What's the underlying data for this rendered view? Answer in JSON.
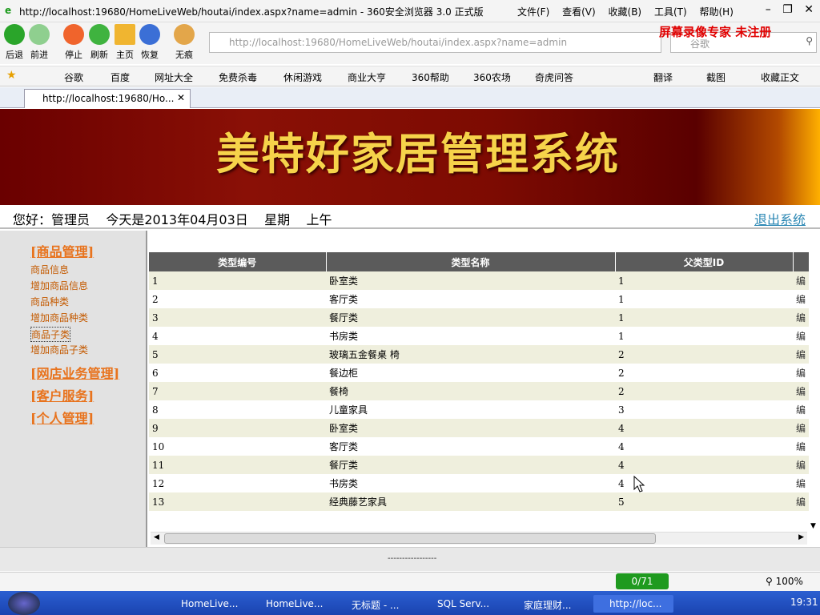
{
  "window": {
    "title": "http://localhost:19680/HomeLiveWeb/houtai/index.aspx?name=admin - 360安全浏览器 3.0 正式版",
    "menu": [
      "文件(F)",
      "查看(V)",
      "收藏(B)",
      "工具(T)",
      "帮助(H)"
    ]
  },
  "watermark": "屏幕录像专家  未注册",
  "toolbar": {
    "buttons": [
      "后退",
      "前进",
      "停止",
      "刷新",
      "主页",
      "恢复",
      "无痕"
    ],
    "address": "http://localhost:19680/HomeLiveWeb/houtai/index.aspx?name=admin",
    "search_placeholder": "谷歌"
  },
  "favorites": [
    "谷歌",
    "百度",
    "网址大全",
    "免费杀毒",
    "休闲游戏",
    "商业大亨",
    "360帮助",
    "360农场",
    "奇虎问答",
    "翻译",
    "截图",
    "收藏正文"
  ],
  "tab": {
    "label": "http://localhost:19680/Ho..."
  },
  "banner": {
    "title": "美特好家居管理系统"
  },
  "info": {
    "greeting": "您好：管理员    今天是2013年04月03日    星期    上午",
    "logout": "退出系统"
  },
  "sidebar": {
    "sections": [
      {
        "title": "[商品管理]",
        "items": [
          "商品信息",
          "增加商品信息",
          "商品种类",
          "增加商品种类",
          "商品子类",
          "增加商品子类"
        ]
      },
      {
        "title": "[网店业务管理]",
        "items": []
      },
      {
        "title": "[客户服务]",
        "items": []
      },
      {
        "title": "[个人管理]",
        "items": []
      }
    ]
  },
  "grid": {
    "headers": [
      "类型编号",
      "类型名称",
      "父类型ID",
      ""
    ],
    "rows": [
      [
        "1",
        "卧室类",
        "1",
        "编"
      ],
      [
        "2",
        "客厅类",
        "1",
        "编"
      ],
      [
        "3",
        "餐厅类",
        "1",
        "编"
      ],
      [
        "4",
        "书房类",
        "1",
        "编"
      ],
      [
        "5",
        "玻璃五金餐桌 椅",
        "2",
        "编"
      ],
      [
        "6",
        "餐边柜",
        "2",
        "编"
      ],
      [
        "7",
        "餐椅",
        "2",
        "编"
      ],
      [
        "8",
        "儿童家具",
        "3",
        "编"
      ],
      [
        "9",
        "卧室类",
        "4",
        "编"
      ],
      [
        "10",
        "客厅类",
        "4",
        "编"
      ],
      [
        "11",
        "餐厅类",
        "4",
        "编"
      ],
      [
        "12",
        "书房类",
        "4",
        "编"
      ],
      [
        "13",
        "经典藤艺家具",
        "5",
        "编"
      ]
    ]
  },
  "footer": {
    "dashes": "-----------------"
  },
  "status": {
    "counter": "0/71",
    "zoom": "100%"
  },
  "taskbar": {
    "tasks": [
      "HomeLive...",
      "HomeLive...",
      "无标题 - ...",
      "SQL Serv...",
      "家庭理财...",
      "http://loc..."
    ],
    "clock": "19:31"
  },
  "colors": {
    "accent": "#e8731d",
    "header_bg": "#5b5b5b",
    "row_alt": "#efefdd",
    "banner_text": "#f6d34a",
    "link": "#2b87b3"
  }
}
